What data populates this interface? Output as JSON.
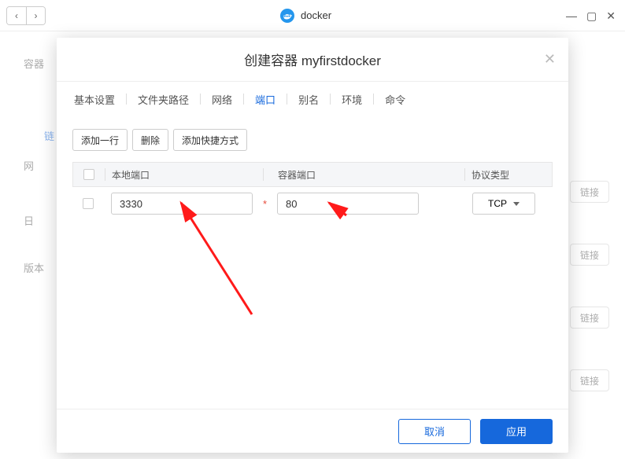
{
  "window": {
    "title": "docker",
    "back_glyph": "‹",
    "fwd_glyph": "›",
    "min": "—",
    "max": "▢",
    "close": "✕"
  },
  "bg": {
    "row1": "容器",
    "row2": "网",
    "row3": "日",
    "row4": "版本",
    "link_btn": "链接",
    "blue_cut": "链"
  },
  "modal": {
    "title": "创建容器 myfirstdocker",
    "close": "✕",
    "tabs": {
      "basic": "基本设置",
      "folder": "文件夹路径",
      "network": "网络",
      "port": "端口",
      "alias": "别名",
      "env": "环境",
      "cmd": "命令"
    },
    "toolbar": {
      "add_row": "添加一行",
      "delete": "删除",
      "add_shortcut": "添加快捷方式"
    },
    "headers": {
      "local": "本地端口",
      "container": "容器端口",
      "protocol": "协议类型"
    },
    "row": {
      "local_port": "3330",
      "container_port": "80",
      "protocol": "TCP"
    },
    "footer": {
      "cancel": "取消",
      "apply": "应用"
    }
  }
}
